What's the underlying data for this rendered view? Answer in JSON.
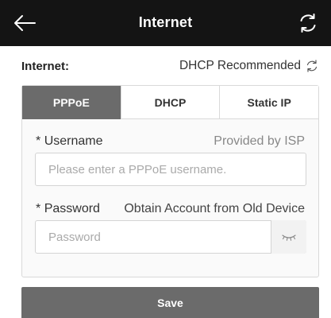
{
  "header": {
    "title": "Internet",
    "back_icon": "arrow-left-icon",
    "refresh_icon": "refresh-icon",
    "background": "#141414"
  },
  "connection": {
    "label": "Internet:",
    "value": "DHCP Recommended",
    "refresh_icon": "refresh-icon"
  },
  "tabs": [
    {
      "label": "PPPoE",
      "active": true
    },
    {
      "label": "DHCP",
      "active": false
    },
    {
      "label": "Static IP",
      "active": false
    }
  ],
  "form": {
    "username": {
      "required_mark": "*",
      "label": "Username",
      "hint": "Provided by ISP",
      "value": "",
      "placeholder": "Please enter a PPPoE username."
    },
    "password": {
      "required_mark": "*",
      "label": "Password",
      "hint": "Obtain Account from Old Device",
      "value": "",
      "placeholder": "Password",
      "toggle_icon": "eye-closed-icon"
    }
  },
  "save_label": "Save",
  "colors": {
    "active_tab": "#6b6b6b",
    "save_button": "#6b6b6b"
  }
}
